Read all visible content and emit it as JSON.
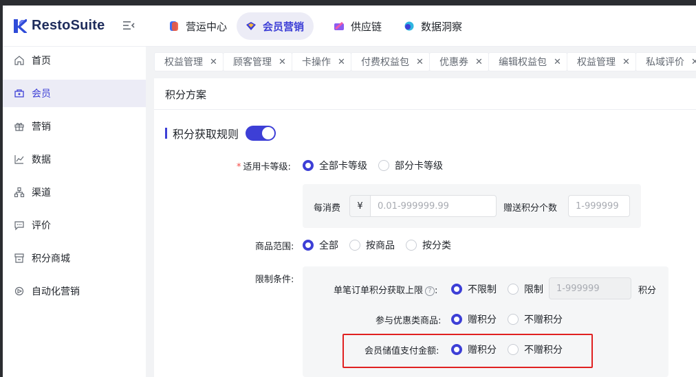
{
  "app": {
    "name": "RestoSuite"
  },
  "top_nav": [
    {
      "label": "营运中心",
      "icon": "ops-center-icon",
      "active": false
    },
    {
      "label": "会员营销",
      "icon": "member-marketing-icon",
      "active": true
    },
    {
      "label": "供应链",
      "icon": "supply-chain-icon",
      "active": false
    },
    {
      "label": "数据洞察",
      "icon": "data-insight-icon",
      "active": false
    }
  ],
  "sidebar": {
    "items": [
      {
        "label": "首页",
        "icon": "home-icon"
      },
      {
        "label": "会员",
        "icon": "member-icon",
        "active": true
      },
      {
        "label": "营销",
        "icon": "gift-icon"
      },
      {
        "label": "数据",
        "icon": "line-chart-icon"
      },
      {
        "label": "渠道",
        "icon": "channel-icon"
      },
      {
        "label": "评价",
        "icon": "comment-icon"
      },
      {
        "label": "积分商城",
        "icon": "mall-icon"
      },
      {
        "label": "自动化营销",
        "icon": "automation-icon"
      }
    ]
  },
  "page_tabs": [
    {
      "label": "权益管理"
    },
    {
      "label": "顾客管理"
    },
    {
      "label": "卡操作"
    },
    {
      "label": "付费权益包"
    },
    {
      "label": "优惠券"
    },
    {
      "label": "编辑权益包"
    },
    {
      "label": "权益管理"
    },
    {
      "label": "私域评价"
    }
  ],
  "page": {
    "title": "积分方案",
    "section_title": "积分获取规则",
    "rule_enabled": true
  },
  "form": {
    "card_level": {
      "label": "适用卡等级:",
      "required_mark": "*",
      "options": [
        "全部卡等级",
        "部分卡等级"
      ],
      "selected": "全部卡等级"
    },
    "spend": {
      "label": "每消费",
      "prefix": "¥",
      "placeholder": "0.01-999999.99",
      "points_label": "赠送积分个数",
      "points_placeholder": "1-999999"
    },
    "product_scope": {
      "label": "商品范围:",
      "options": [
        "全部",
        "按商品",
        "按分类"
      ],
      "selected": "全部"
    },
    "limits": {
      "label": "限制条件:",
      "order_cap": {
        "label": "单笔订单积分获取上限",
        "help": "?",
        "colon": ":",
        "options": [
          "不限制",
          "限制"
        ],
        "selected": "不限制",
        "placeholder": "1-999999",
        "unit": "积分"
      },
      "discount_goods": {
        "label": "参与优惠类商品:",
        "options": [
          "赠积分",
          "不赠积分"
        ],
        "selected": "赠积分"
      },
      "stored_value": {
        "label": "会员储值支付金额:",
        "options": [
          "赠积分",
          "不赠积分"
        ],
        "selected": "赠积分"
      }
    }
  },
  "colors": {
    "primary": "#3d3fd6",
    "highlight": "#e02020"
  }
}
